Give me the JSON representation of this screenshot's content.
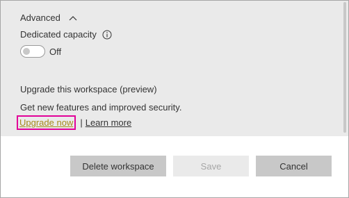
{
  "advanced": {
    "label": "Advanced",
    "expanded": true
  },
  "dedicated_capacity": {
    "label": "Dedicated capacity",
    "info_icon": "info-icon",
    "toggle_state": "Off"
  },
  "upgrade": {
    "title": "Upgrade this workspace (preview)",
    "description": "Get new features and improved security.",
    "upgrade_link": "Upgrade now",
    "separator": "|",
    "learn_link": "Learn more"
  },
  "buttons": {
    "delete_label": "Delete workspace",
    "save_label": "Save",
    "cancel_label": "Cancel"
  },
  "colors": {
    "panel_bg": "#eaeaea",
    "highlight_border": "#e10098",
    "upgrade_link": "#a58a1a",
    "button_bg": "#c8c8c8",
    "disabled_text": "#a6a6a6"
  }
}
